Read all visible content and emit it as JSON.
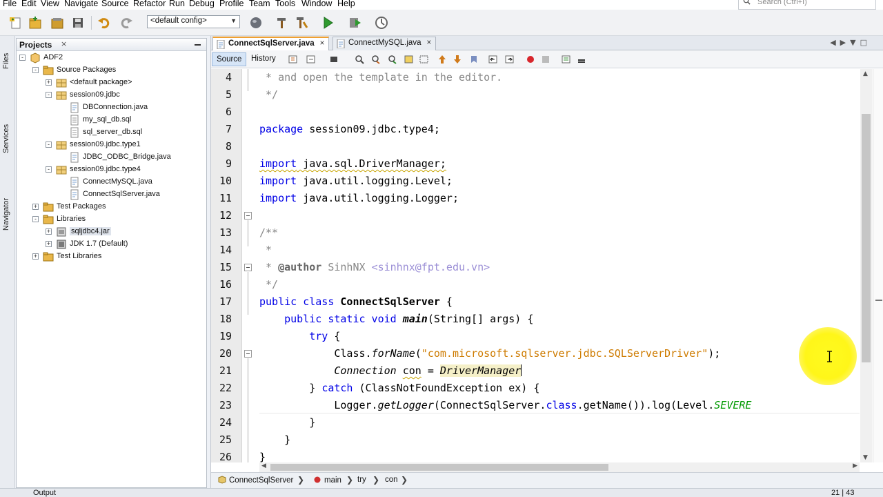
{
  "menu": [
    "File",
    "Edit",
    "View",
    "Navigate",
    "Source",
    "Refactor",
    "Run",
    "Debug",
    "Profile",
    "Team",
    "Tools",
    "Window",
    "Help"
  ],
  "search": {
    "placeholder": "Search (Ctrl+I)"
  },
  "toolbar": {
    "config": "<default config>"
  },
  "side_strip": {
    "files": "Files",
    "services": "Services",
    "navigator": "Navigator"
  },
  "projects": {
    "title": "Projects",
    "close": "×",
    "tree": [
      {
        "label": "ADF2",
        "icon": "project-icon"
      },
      {
        "label": "Source Packages",
        "icon": "folder-icon"
      },
      {
        "label": "<default package>",
        "icon": "package-icon"
      },
      {
        "label": "session09.jdbc",
        "icon": "package-icon"
      },
      {
        "label": "DBConnection.java",
        "icon": "java-file-icon"
      },
      {
        "label": "my_sql_db.sql",
        "icon": "sql-file-icon"
      },
      {
        "label": "sql_server_db.sql",
        "icon": "sql-file-icon"
      },
      {
        "label": "session09.jdbc.type1",
        "icon": "package-icon"
      },
      {
        "label": "JDBC_ODBC_Bridge.java",
        "icon": "java-file-icon"
      },
      {
        "label": "session09.jdbc.type4",
        "icon": "package-icon"
      },
      {
        "label": "ConnectMySQL.java",
        "icon": "java-file-icon"
      },
      {
        "label": "ConnectSqlServer.java",
        "icon": "java-file-icon"
      },
      {
        "label": "Test Packages",
        "icon": "folder-icon"
      },
      {
        "label": "Libraries",
        "icon": "folder-icon"
      },
      {
        "label": "sqljdbc4.jar",
        "icon": "jar-icon"
      },
      {
        "label": "JDK 1.7 (Default)",
        "icon": "jdk-icon"
      },
      {
        "label": "Test Libraries",
        "icon": "folder-icon"
      }
    ]
  },
  "editor": {
    "tabs": [
      {
        "label": "ConnectSqlServer.java",
        "close": "×"
      },
      {
        "label": "ConnectMySQL.java",
        "close": "×"
      }
    ],
    "modes": {
      "source": "Source",
      "history": "History"
    },
    "line_numbers": [
      "4",
      "5",
      "6",
      "7",
      "8",
      "9",
      "10",
      "11",
      "12",
      "13",
      "14",
      "15",
      "16",
      "17",
      "18",
      "19",
      "20",
      "21",
      "22",
      "23",
      "24",
      "25",
      "26"
    ],
    "code": {
      "l4": " * and open the template in the editor.",
      "l5": " */",
      "l7a": "package",
      "l7b": " session09.jdbc.type4;",
      "l9a": "import",
      "l9b": " java.sql.DriverManager;",
      "l10a": "import",
      "l10b": " java.util.logging.Level;",
      "l11a": "import",
      "l11b": " java.util.logging.Logger;",
      "l13": "/**",
      "l14": " *",
      "l15a": " * ",
      "l15b": "@author",
      "l15c": " SinhNX ",
      "l15d": "<sinhnx@fpt.edu.vn>",
      "l16": " */",
      "l17a": "public class",
      "l17b": " ",
      "l17c": "ConnectSqlServer",
      "l17d": " {",
      "l18a": "    public static void",
      "l18b": " ",
      "l18c": "main",
      "l18d": "(String[] args) {",
      "l19a": "        try",
      "l19b": " {",
      "l20a": "            Class.",
      "l20b": "forName",
      "l20c": "(",
      "l20d": "\"com.microsoft.sqlserver.jdbc.SQLServerDriver\"",
      "l20e": ");",
      "l21a": "            ",
      "l21b": "Connection",
      "l21c": " ",
      "l21d": "con",
      "l21e": " = ",
      "l21f": "DriverManager",
      "l22a": "        } ",
      "l22b": "catch",
      "l22c": " (ClassNotFoundException ex) {",
      "l23a": "            Logger.",
      "l23b": "getLogger",
      "l23c": "(ConnectSqlServer.",
      "l23d": "class",
      "l23e": ".getName()).log(Level.",
      "l23f": "SEVERE",
      "l24": "        }",
      "l25": "    }",
      "l26": "}"
    }
  },
  "breadcrumbs": [
    "ConnectSqlServer",
    "main",
    "try",
    "con"
  ],
  "status": {
    "output": "Output",
    "position": "21 | 43"
  },
  "colors": {
    "keyword": "#0000e6",
    "comment": "#888888",
    "string": "#ce7b00",
    "highlight": "#fff500"
  }
}
